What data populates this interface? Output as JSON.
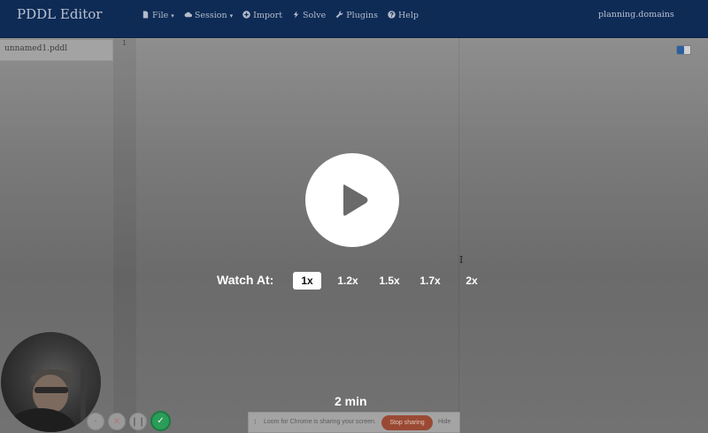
{
  "navbar": {
    "brand": "PDDL Editor",
    "menu": [
      {
        "label": "File",
        "icon": "file-icon",
        "dropdown": true
      },
      {
        "label": "Session",
        "icon": "cloud-icon",
        "dropdown": true
      },
      {
        "label": "Import",
        "icon": "plus-circle-icon",
        "dropdown": false
      },
      {
        "label": "Solve",
        "icon": "bolt-icon",
        "dropdown": false
      },
      {
        "label": "Plugins",
        "icon": "wrench-icon",
        "dropdown": false
      },
      {
        "label": "Help",
        "icon": "question-circle-icon",
        "dropdown": false
      }
    ],
    "site": "planning.domains"
  },
  "editor": {
    "file_tab": "unnamed1.pddl",
    "line_number": "1",
    "cursor_glyph": "I"
  },
  "player": {
    "watch_label": "Watch At:",
    "speeds": [
      "1x",
      "1.2x",
      "1.5x",
      "1.7x",
      "2x"
    ],
    "selected_speed": "1x",
    "duration": "2 min"
  },
  "recorder": {
    "buttons": [
      "delete",
      "cancel",
      "pause",
      "done"
    ]
  },
  "share_bar": {
    "text": "Loom for Chrome is sharing your screen.",
    "stop_label": "Stop sharing",
    "hide_label": "Hide"
  },
  "colors": {
    "navbar": "#0e2b56",
    "accent": "#2b5fa0",
    "done": "#2a9d58",
    "stop": "#9a4a34"
  }
}
